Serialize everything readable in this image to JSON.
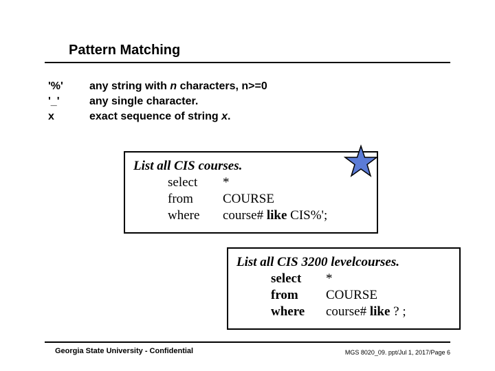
{
  "title": "Pattern Matching",
  "patterns": {
    "rows": [
      {
        "sym": "'%'",
        "pre": "any string with ",
        "ital": "n",
        "post": " characters, n>=0"
      },
      {
        "sym": "'_'",
        "pre": "any single character.",
        "ital": "",
        "post": ""
      },
      {
        "sym": "x",
        "pre": "exact sequence of string ",
        "ital": "x",
        "post": "."
      }
    ]
  },
  "box1": {
    "head": "List all CIS courses.",
    "lines": [
      {
        "kw": "select",
        "val": "*"
      },
      {
        "kw": "from",
        "val": "COURSE"
      },
      {
        "kw": "where",
        "val": "course# like CIS%';"
      }
    ],
    "bold_kw": false,
    "bold_like": true
  },
  "box2": {
    "head": "List all CIS 3200 levelcourses.",
    "lines": [
      {
        "kw": "select",
        "val": "*"
      },
      {
        "kw": "from",
        "val": "COURSE"
      },
      {
        "kw": "where",
        "val_pre": "course# ",
        "val_like": "like",
        "val_post": "   ?   ;"
      }
    ],
    "bold_kw": true
  },
  "footer": {
    "left": "Georgia State University - Confidential",
    "right": "MGS 8020_09. ppt/Jul 1, 2017/Page 6"
  },
  "icons": {
    "star": "star-icon"
  }
}
